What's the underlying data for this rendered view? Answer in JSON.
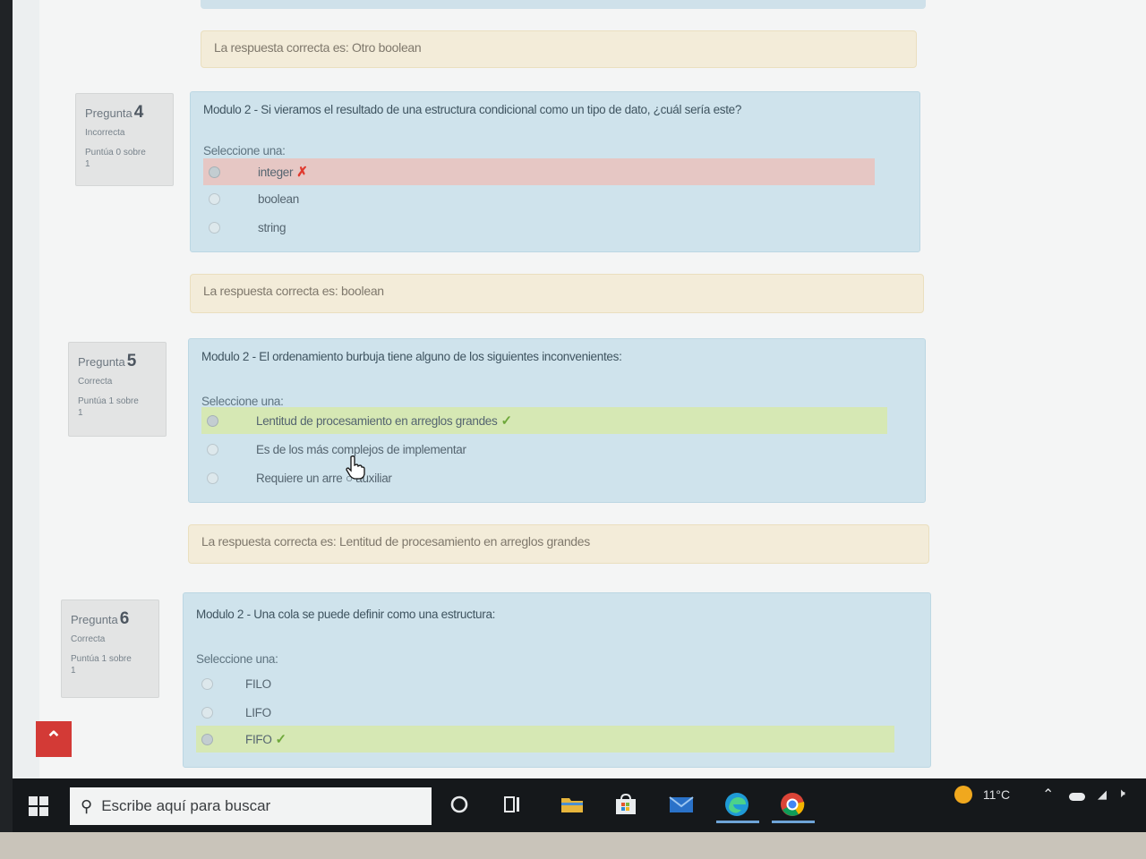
{
  "feedback_prev": {
    "text": "La respuesta correcta es: Otro boolean"
  },
  "questions": [
    {
      "title": "Pregunta",
      "number": "4",
      "state": "Incorrecta",
      "grade_line1": "Puntúa 0 sobre",
      "grade_line2": "1",
      "text": "Modulo 2 - Si vieramos el resultado de una estructura condicional como un tipo de dato, ¿cuál sería este?",
      "prompt": "Seleccione una:",
      "options": [
        {
          "label": "integer",
          "selected": true,
          "mark": "✗",
          "status": "incorrect"
        },
        {
          "label": "boolean",
          "selected": false
        },
        {
          "label": "string",
          "selected": false
        }
      ],
      "feedback": "La respuesta correcta es: boolean"
    },
    {
      "title": "Pregunta",
      "number": "5",
      "state": "Correcta",
      "grade_line1": "Puntúa 1 sobre",
      "grade_line2": "1",
      "text": "Modulo 2 - El ordenamiento burbuja tiene alguno de los siguientes inconvenientes:",
      "prompt": "Seleccione una:",
      "options": [
        {
          "label": "Lentitud de procesamiento en arreglos grandes",
          "selected": true,
          "mark": "✓",
          "status": "correct"
        },
        {
          "label": "Es de los más complejos de implementar",
          "selected": false
        },
        {
          "label": "Requiere un arre ○ auxiliar",
          "selected": false
        }
      ],
      "feedback": "La respuesta correcta es: Lentitud de procesamiento en arreglos grandes"
    },
    {
      "title": "Pregunta",
      "number": "6",
      "state": "Correcta",
      "grade_line1": "Puntúa 1 sobre",
      "grade_line2": "1",
      "text": "Modulo 2 - Una cola se puede definir como una estructura:",
      "prompt": "Seleccione una:",
      "options": [
        {
          "label": "FILO",
          "selected": false
        },
        {
          "label": "LIFO",
          "selected": false
        },
        {
          "label": "FIFO",
          "selected": true,
          "mark": "✓",
          "status": "correct"
        }
      ]
    }
  ],
  "taskbar": {
    "search_placeholder": "Escribe aquí para buscar",
    "temperature": "11°C",
    "icons": [
      "windows-start-icon",
      "search-icon",
      "cortana-icon",
      "task-view-icon",
      "file-explorer-icon",
      "store-icon",
      "mail-icon",
      "edge-icon",
      "chrome-icon"
    ]
  },
  "colors": {
    "question_bg": "#cfe3ec",
    "feedback_bg": "#f3ecd9",
    "incorrect_bg": "#e6c7c4",
    "correct_bg": "#d6e8b4",
    "scroll_button": "#d33a36"
  }
}
